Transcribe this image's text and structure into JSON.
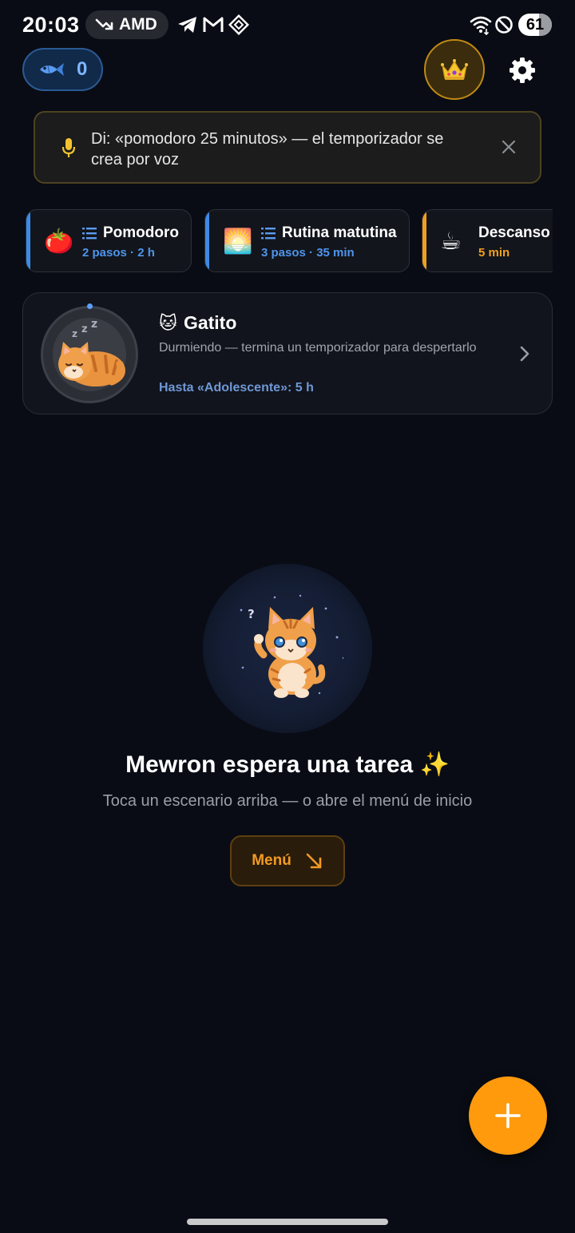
{
  "status_bar": {
    "time": "20:03",
    "stock_label": "AMD",
    "battery_level": "61"
  },
  "header": {
    "fish_count": "0",
    "fish_icon": "fish-icon",
    "premium_icon": "crown-icon",
    "settings_icon": "gear-icon"
  },
  "voice_hint": {
    "text": "Di: «pomodoro 25 minutos» — el temporizador se crea por voz"
  },
  "scenarios": [
    {
      "emoji": "🍅",
      "title": "Pomodoro",
      "subtitle": "2 pasos · 2 h",
      "accent": "#3d8ae6",
      "has_steps_icon": true
    },
    {
      "emoji": "🌅",
      "title": "Rutina matutina",
      "subtitle": "3 pasos · 35 min",
      "accent": "#3d8ae6",
      "has_steps_icon": true
    },
    {
      "emoji": "☕",
      "title": "Descanso",
      "subtitle": "5 min",
      "accent": "#f0a020",
      "has_steps_icon": false
    }
  ],
  "pet": {
    "emoji": "🐱",
    "name": "Gatito",
    "status": "Durmiendo — termina un temporizador para despertarlo",
    "progress": "Hasta «Adolescente»: 5 h"
  },
  "empty_state": {
    "title": "Mewron espera una tarea ✨",
    "subtitle": "Toca un escenario arriba — o abre el menú de inicio",
    "menu_label": "Menú"
  },
  "colors": {
    "background": "#090c14",
    "accent_orange": "#ff9a0c",
    "accent_blue": "#3d8ae6"
  }
}
